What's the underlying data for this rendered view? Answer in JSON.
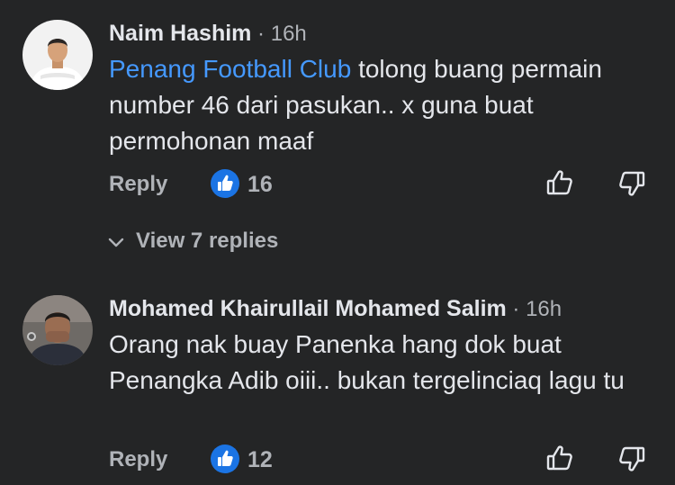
{
  "comments": [
    {
      "author": "Naim Hashim",
      "time": "16h",
      "mention": "Penang Football Club",
      "text": " tolong buang permain number 46 dari pasukan.. x guna buat permohonan maaf",
      "reply_label": "Reply",
      "like_count": "16",
      "view_replies": "View 7 replies"
    },
    {
      "author": "Mohamed Khairullail Mohamed Salim",
      "time": "16h",
      "text": "Orang nak buay Panenka hang dok buat Penangka Adib oiii.. bukan tergelinciaq lagu tu",
      "reply_label": "Reply",
      "like_count": "12"
    }
  ],
  "separator": " · ",
  "colors": {
    "background": "#242526",
    "text": "#e4e6eb",
    "secondary": "#b0b3b8",
    "mention": "#4599ff",
    "like_badge": "#1b74e4"
  },
  "icons": {
    "like": "thumbs-up-icon",
    "dislike": "thumbs-down-icon",
    "expand": "chevron-down-icon"
  }
}
